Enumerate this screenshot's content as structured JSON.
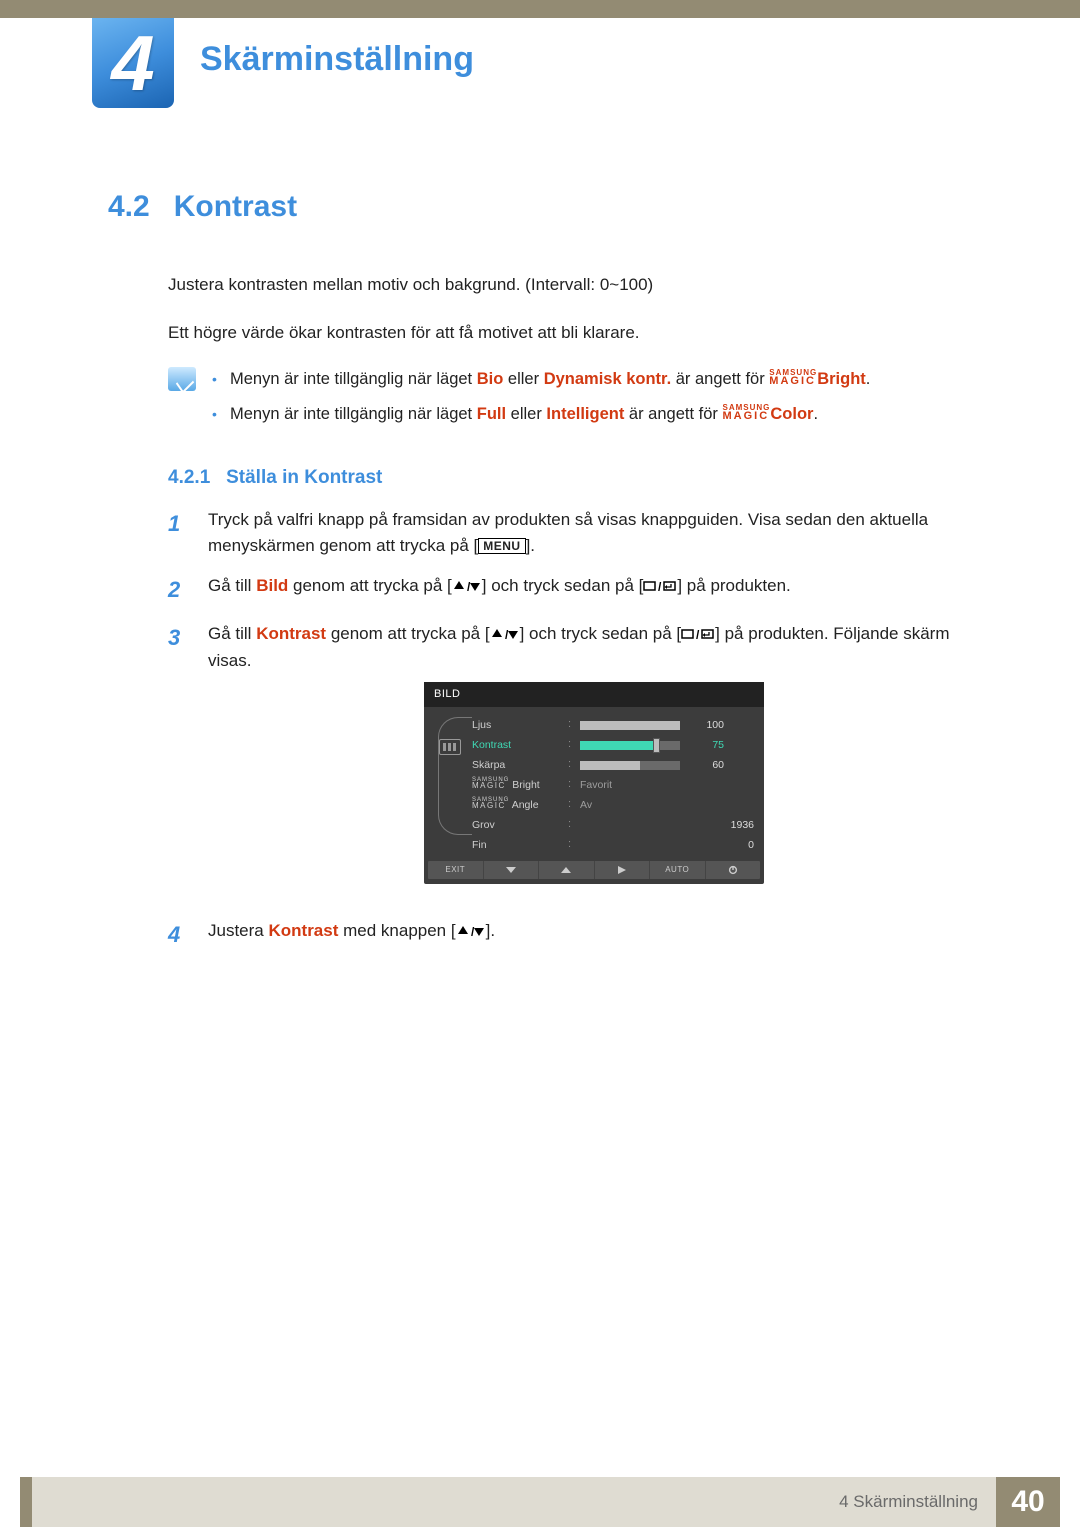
{
  "chapter": {
    "number": "4",
    "title": "Skärminställning"
  },
  "section": {
    "number": "4.2",
    "title": "Kontrast"
  },
  "intro": {
    "p1": "Justera kontrasten mellan motiv och bakgrund. (Intervall: 0~100)",
    "p2": "Ett högre värde ökar kontrasten för att få motivet att bli klarare."
  },
  "notes": {
    "n1": {
      "pre": "Menyn är inte tillgänglig när läget ",
      "h1": "Bio",
      "mid1": " eller ",
      "h2": "Dynamisk kontr.",
      "mid2": " är angett för ",
      "suffix": "Bright",
      "end": "."
    },
    "n2": {
      "pre": "Menyn är inte tillgänglig när läget ",
      "h1": "Full",
      "mid1": " eller ",
      "h2": "Intelligent",
      "mid2": " är angett för ",
      "suffix": "Color",
      "end": "."
    }
  },
  "subsection": {
    "number": "4.2.1",
    "title": "Ställa in Kontrast"
  },
  "steps": {
    "s1": {
      "num": "1",
      "text_a": "Tryck på valfri knapp på framsidan av produkten så visas knappguiden. Visa sedan den aktuella menyskärmen genom att trycka på [",
      "text_b": "]."
    },
    "s2": {
      "num": "2",
      "a": "Gå till ",
      "h": "Bild",
      "b": " genom att trycka på [",
      "c": "] och tryck sedan på [",
      "d": "] på produkten."
    },
    "s3": {
      "num": "3",
      "a": "Gå till ",
      "h": "Kontrast",
      "b": " genom att trycka på [",
      "c": "] och tryck sedan på [",
      "d": "] på produkten. Följande skärm visas."
    },
    "s4": {
      "num": "4",
      "a": "Justera ",
      "h": "Kontrast",
      "b": " med knappen [",
      "c": "]."
    }
  },
  "menu_key": "MENU",
  "osd": {
    "title": "BILD",
    "rows": {
      "r1": {
        "label": "Ljus",
        "value": "100",
        "fill": 100
      },
      "r2": {
        "label": "Kontrast",
        "value": "75",
        "fill": 75
      },
      "r3": {
        "label": "Skärpa",
        "value": "60",
        "fill": 60
      },
      "r4": {
        "label_suffix": "Bright",
        "text": "Favorit"
      },
      "r5": {
        "label_suffix": "Angle",
        "text": "Av"
      },
      "r6": {
        "label": "Grov",
        "value": "1936"
      },
      "r7": {
        "label": "Fin",
        "value": "0"
      }
    },
    "footer": {
      "exit": "EXIT",
      "auto": "AUTO"
    }
  },
  "magic": {
    "samsung": "SAMSUNG",
    "magic": "MAGIC"
  },
  "footer": {
    "text": "4 Skärminställning",
    "page": "40"
  }
}
